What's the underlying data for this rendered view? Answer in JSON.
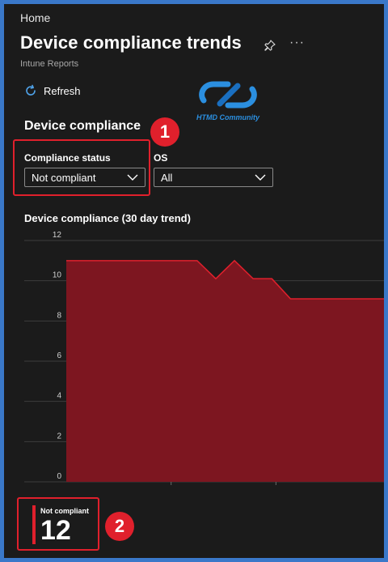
{
  "header": {
    "breadcrumb": "Home",
    "title": "Device compliance trends",
    "subtitle": "Intune Reports",
    "more_label": "···"
  },
  "toolbar": {
    "refresh_label": "Refresh"
  },
  "watermark": {
    "text": "HTMD Community"
  },
  "section": {
    "title": "Device compliance"
  },
  "annotations": {
    "badge_1": "1",
    "badge_2": "2"
  },
  "filters": {
    "compliance_status": {
      "label": "Compliance status",
      "value": "Not compliant"
    },
    "os": {
      "label": "OS",
      "value": "All"
    }
  },
  "chart_data": {
    "type": "area",
    "title": "Device compliance (30 day trend)",
    "xlabel": "",
    "ylabel": "",
    "ylim": [
      0,
      12
    ],
    "yticks": [
      0,
      2,
      4,
      6,
      8,
      10,
      12
    ],
    "grid": true,
    "series": [
      {
        "x": [
          0,
          1,
          2,
          3,
          4,
          5,
          6,
          7,
          8,
          9,
          10,
          11,
          12,
          13,
          14,
          15,
          16,
          17
        ],
        "values": [
          11,
          11,
          11,
          11,
          11,
          11,
          11,
          11,
          10.1,
          11,
          10.1,
          10.1,
          9.1,
          9.1,
          9.1,
          9.1,
          9.1,
          9.1
        ]
      }
    ]
  },
  "summary_card": {
    "label": "Not compliant",
    "value": "12"
  },
  "colors": {
    "accent": "#e0202c",
    "area_fill": "#7d1620",
    "area_line": "#e0202c",
    "border": "#3a78c9"
  }
}
